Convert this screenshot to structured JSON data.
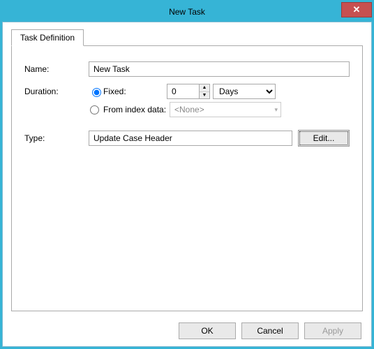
{
  "window": {
    "title": "New Task"
  },
  "tabs": [
    {
      "label": "Task Definition"
    }
  ],
  "form": {
    "name_label": "Name:",
    "name_value": "New Task",
    "duration_label": "Duration:",
    "fixed_label": "Fixed:",
    "fixed_value": "0",
    "fixed_unit": "Days",
    "from_index_label": "From index data:",
    "from_index_value": "<None>",
    "type_label": "Type:",
    "type_value": "Update Case Header",
    "edit_label": "Edit..."
  },
  "buttons": {
    "ok": "OK",
    "cancel": "Cancel",
    "apply": "Apply"
  }
}
